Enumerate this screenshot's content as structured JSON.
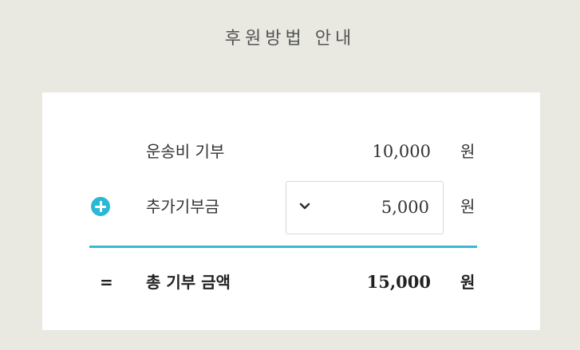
{
  "page": {
    "title": "후원방법 안내"
  },
  "donation_summary": {
    "shipping": {
      "label": "운송비 기부",
      "amount": "10,000",
      "unit": "원"
    },
    "extra": {
      "label": "추가기부금",
      "selected_amount": "5,000",
      "unit": "원",
      "icon": "plus-icon",
      "dropdown_icon": "chevron-down-icon"
    },
    "total": {
      "symbol": "=",
      "label": "총 기부 금액",
      "amount": "15,000",
      "unit": "원"
    }
  },
  "colors": {
    "background": "#e9e9e2",
    "card": "#ffffff",
    "accent": "#29b8d6"
  }
}
